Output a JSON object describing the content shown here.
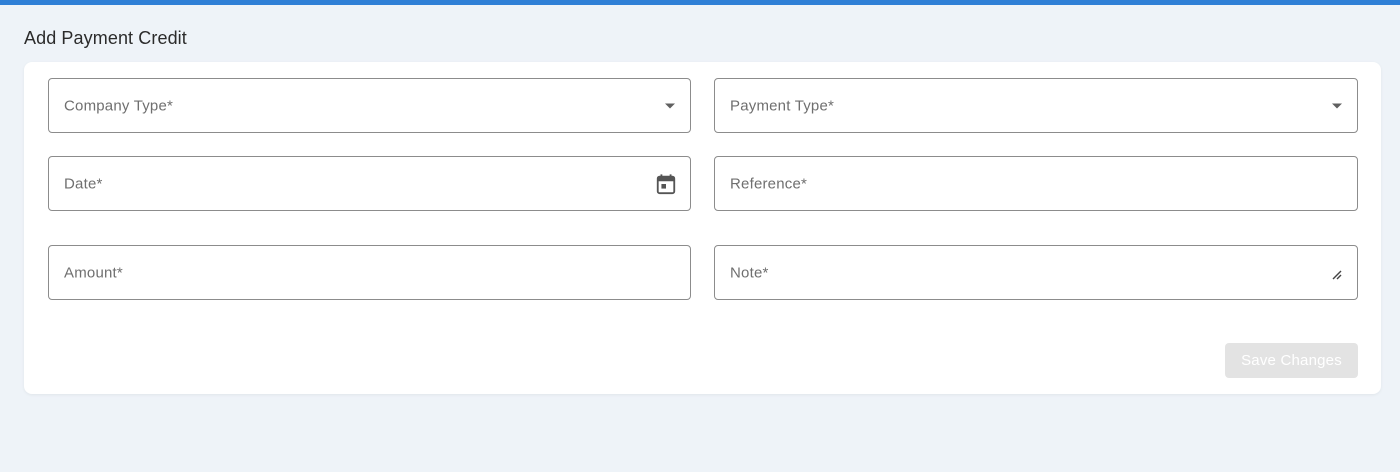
{
  "header": {
    "title": "Add Payment Credit",
    "accent_color": "#2f7fd6"
  },
  "form": {
    "company_type": {
      "label": "Company Type*",
      "icon": "dropdown-caret-icon"
    },
    "payment_type": {
      "label": "Payment Type*",
      "icon": "dropdown-caret-icon"
    },
    "date": {
      "label": "Date*",
      "icon": "calendar-icon"
    },
    "reference": {
      "label": "Reference*"
    },
    "amount": {
      "label": "Amount*"
    },
    "note": {
      "label": "Note*",
      "icon": "resize-handle-icon"
    },
    "save_label": "Save Changes"
  }
}
